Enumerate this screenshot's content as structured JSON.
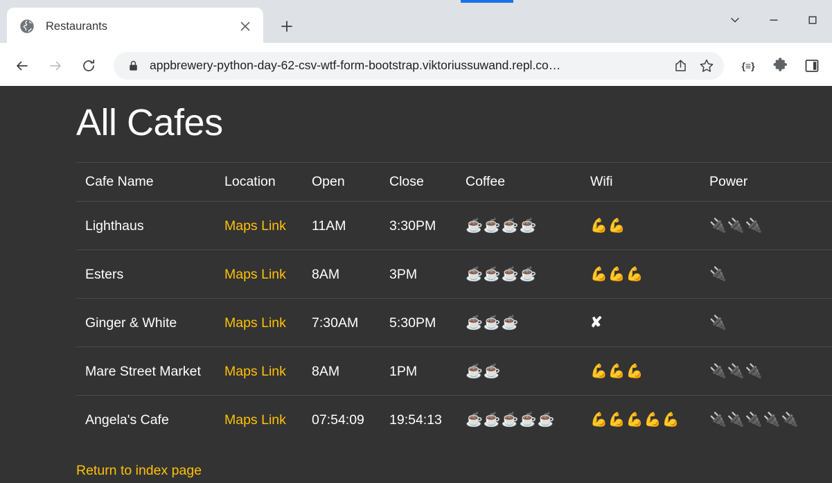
{
  "browser": {
    "tab": {
      "favicon": "globe-icon",
      "title": "Restaurants",
      "close_label": "✕"
    },
    "new_tab_label": "+",
    "window_controls": {
      "tab_search": "tab-search-chevron",
      "minimize": "minimize",
      "maximize": "maximize"
    },
    "toolbar": {
      "back": "back-arrow",
      "forward": "forward-arrow",
      "reload": "reload",
      "lock": "lock-icon",
      "url": "appbrewery-python-day-62-csv-wtf-form-bootstrap.viktoriussuwand.repl.co…",
      "share": "share-icon",
      "bookmark": "star-icon",
      "reading_list": "{≡}",
      "extensions": "puzzle-icon",
      "side_panel": "side-panel-icon"
    }
  },
  "page": {
    "title": "All Cafes",
    "accent_color": "#ffc107",
    "background_color": "#333333",
    "footer_link": "Return to index page",
    "maps_link_label": "Maps Link",
    "table": {
      "headers": [
        "Cafe Name",
        "Location",
        "Open",
        "Close",
        "Coffee",
        "Wifi",
        "Power"
      ],
      "icons": {
        "coffee": "☕",
        "wifi": "💪",
        "power": "🔌",
        "none": "✘"
      },
      "rows": [
        {
          "name": "Lighthaus",
          "location": "Maps Link",
          "open": "11AM",
          "close": "3:30PM",
          "coffee": 4,
          "wifi": 2,
          "power": 3
        },
        {
          "name": "Esters",
          "location": "Maps Link",
          "open": "8AM",
          "close": "3PM",
          "coffee": 4,
          "wifi": 3,
          "power": 1
        },
        {
          "name": "Ginger & White",
          "location": "Maps Link",
          "open": "7:30AM",
          "close": "5:30PM",
          "coffee": 3,
          "wifi": 0,
          "power": 1
        },
        {
          "name": "Mare Street Market",
          "location": "Maps Link",
          "open": "8AM",
          "close": "1PM",
          "coffee": 2,
          "wifi": 3,
          "power": 3
        },
        {
          "name": "Angela's Cafe",
          "location": "Maps Link",
          "open": "07:54:09",
          "close": "19:54:13",
          "coffee": 5,
          "wifi": 5,
          "power": 5
        }
      ]
    }
  }
}
